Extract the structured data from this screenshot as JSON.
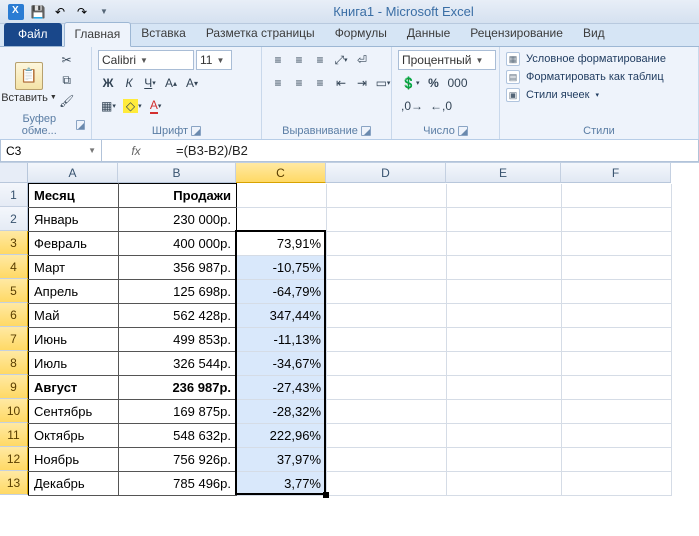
{
  "title": "Книга1 - Microsoft Excel",
  "tabs": {
    "file": "Файл",
    "items": [
      "Главная",
      "Вставка",
      "Разметка страницы",
      "Формулы",
      "Данные",
      "Рецензирование",
      "Вид"
    ],
    "active": 0
  },
  "ribbon": {
    "clipboard": {
      "paste": "Вставить",
      "label": "Буфер обме..."
    },
    "font": {
      "family": "Calibri",
      "size": "11",
      "label": "Шрифт"
    },
    "alignment": {
      "label": "Выравнивание"
    },
    "number": {
      "format": "Процентный",
      "label": "Число"
    },
    "styles": {
      "cond": "Условное форматирование",
      "table": "Форматировать как таблиц",
      "cell": "Стили ячеек",
      "label": "Стили"
    }
  },
  "formula_bar": {
    "namebox": "C3",
    "formula": "=(B3-B2)/B2"
  },
  "columns": [
    "A",
    "B",
    "C",
    "D",
    "E",
    "F"
  ],
  "grid": {
    "header": {
      "A": "Месяц",
      "B": "Продажи"
    },
    "rows": [
      {
        "n": 1,
        "A": "Месяц",
        "B": "Продажи",
        "C": "",
        "header": true
      },
      {
        "n": 2,
        "A": "Январь",
        "B": "230 000р.",
        "C": ""
      },
      {
        "n": 3,
        "A": "Февраль",
        "B": "400 000р.",
        "C": "73,91%",
        "active": true
      },
      {
        "n": 4,
        "A": "Март",
        "B": "356 987р.",
        "C": "-10,75%"
      },
      {
        "n": 5,
        "A": "Апрель",
        "B": "125 698р.",
        "C": "-64,79%"
      },
      {
        "n": 6,
        "A": "Май",
        "B": "562 428р.",
        "C": "347,44%"
      },
      {
        "n": 7,
        "A": "Июнь",
        "B": "499 853р.",
        "C": "-11,13%"
      },
      {
        "n": 8,
        "A": "Июль",
        "B": "326 544р.",
        "C": "-34,67%"
      },
      {
        "n": 9,
        "A": "Август",
        "B": "236 987р.",
        "C": "-27,43%",
        "bold": true
      },
      {
        "n": 10,
        "A": "Сентябрь",
        "B": "169 875р.",
        "C": "-28,32%"
      },
      {
        "n": 11,
        "A": "Октябрь",
        "B": "548 632р.",
        "C": "222,96%"
      },
      {
        "n": 12,
        "A": "Ноябрь",
        "B": "756 926р.",
        "C": "37,97%"
      },
      {
        "n": 13,
        "A": "Декабрь",
        "B": "785 496р.",
        "C": "3,77%"
      }
    ]
  },
  "selection": {
    "col": "C",
    "from_row": 3,
    "to_row": 13
  }
}
